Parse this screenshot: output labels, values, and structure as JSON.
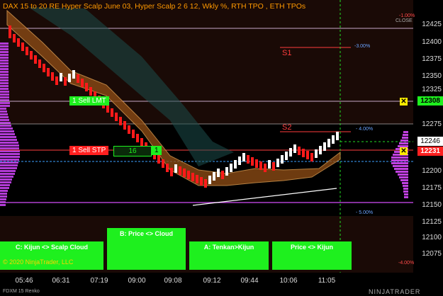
{
  "header": {
    "title": "DAX 15 to 20 RE Hyper Scalp June 03, Hyper Scalp  2 6 12, Wkly %, RTH TPO , ETH TPOs"
  },
  "price_axis": {
    "labels": [
      "12425",
      "12400",
      "12375",
      "12350",
      "12325",
      "12275",
      "12200",
      "12175",
      "12150",
      "12125",
      "12100",
      "12075"
    ],
    "current_price_green": "12308",
    "current_price_red": "12231",
    "last_price_white": "12246"
  },
  "time_axis": {
    "labels": [
      "05:46",
      "06:31",
      "07:19",
      "09:00",
      "09:08",
      "09:12",
      "09:44",
      "10:06",
      "11:05"
    ]
  },
  "orders": {
    "sell_limit": "1  Sell LMT",
    "sell_stop": "1  Sell STP",
    "stop_qty": "16",
    "stop_qty2": "1"
  },
  "levels": {
    "pct_neg1": "-1.00%",
    "close": "CLOSE",
    "pct_neg3": "-3.00%",
    "s1": "S1",
    "s2": "S2",
    "pct_neg4": "- 4.00%",
    "pct_neg5": "- 5.00%",
    "pct_neg4b": "-4.00%"
  },
  "signals": {
    "kijun_scalp": "C: Kijun <> Scalp Cloud",
    "price_cloud": "B: Price <> Cloud",
    "tenkan_kijun": "A: Tenkan>Kijun",
    "price_kijun": "Price <> Kijun"
  },
  "footer": {
    "copyright": "© 2020 NinjaTrader, LLC",
    "instrument": "FDXM 15 Renko",
    "brand": "NINJATRADER"
  },
  "colors": {
    "up": "#ffffff",
    "down": "#ff1a1a",
    "signal": "#1ef01e",
    "accent": "#ff9900"
  }
}
